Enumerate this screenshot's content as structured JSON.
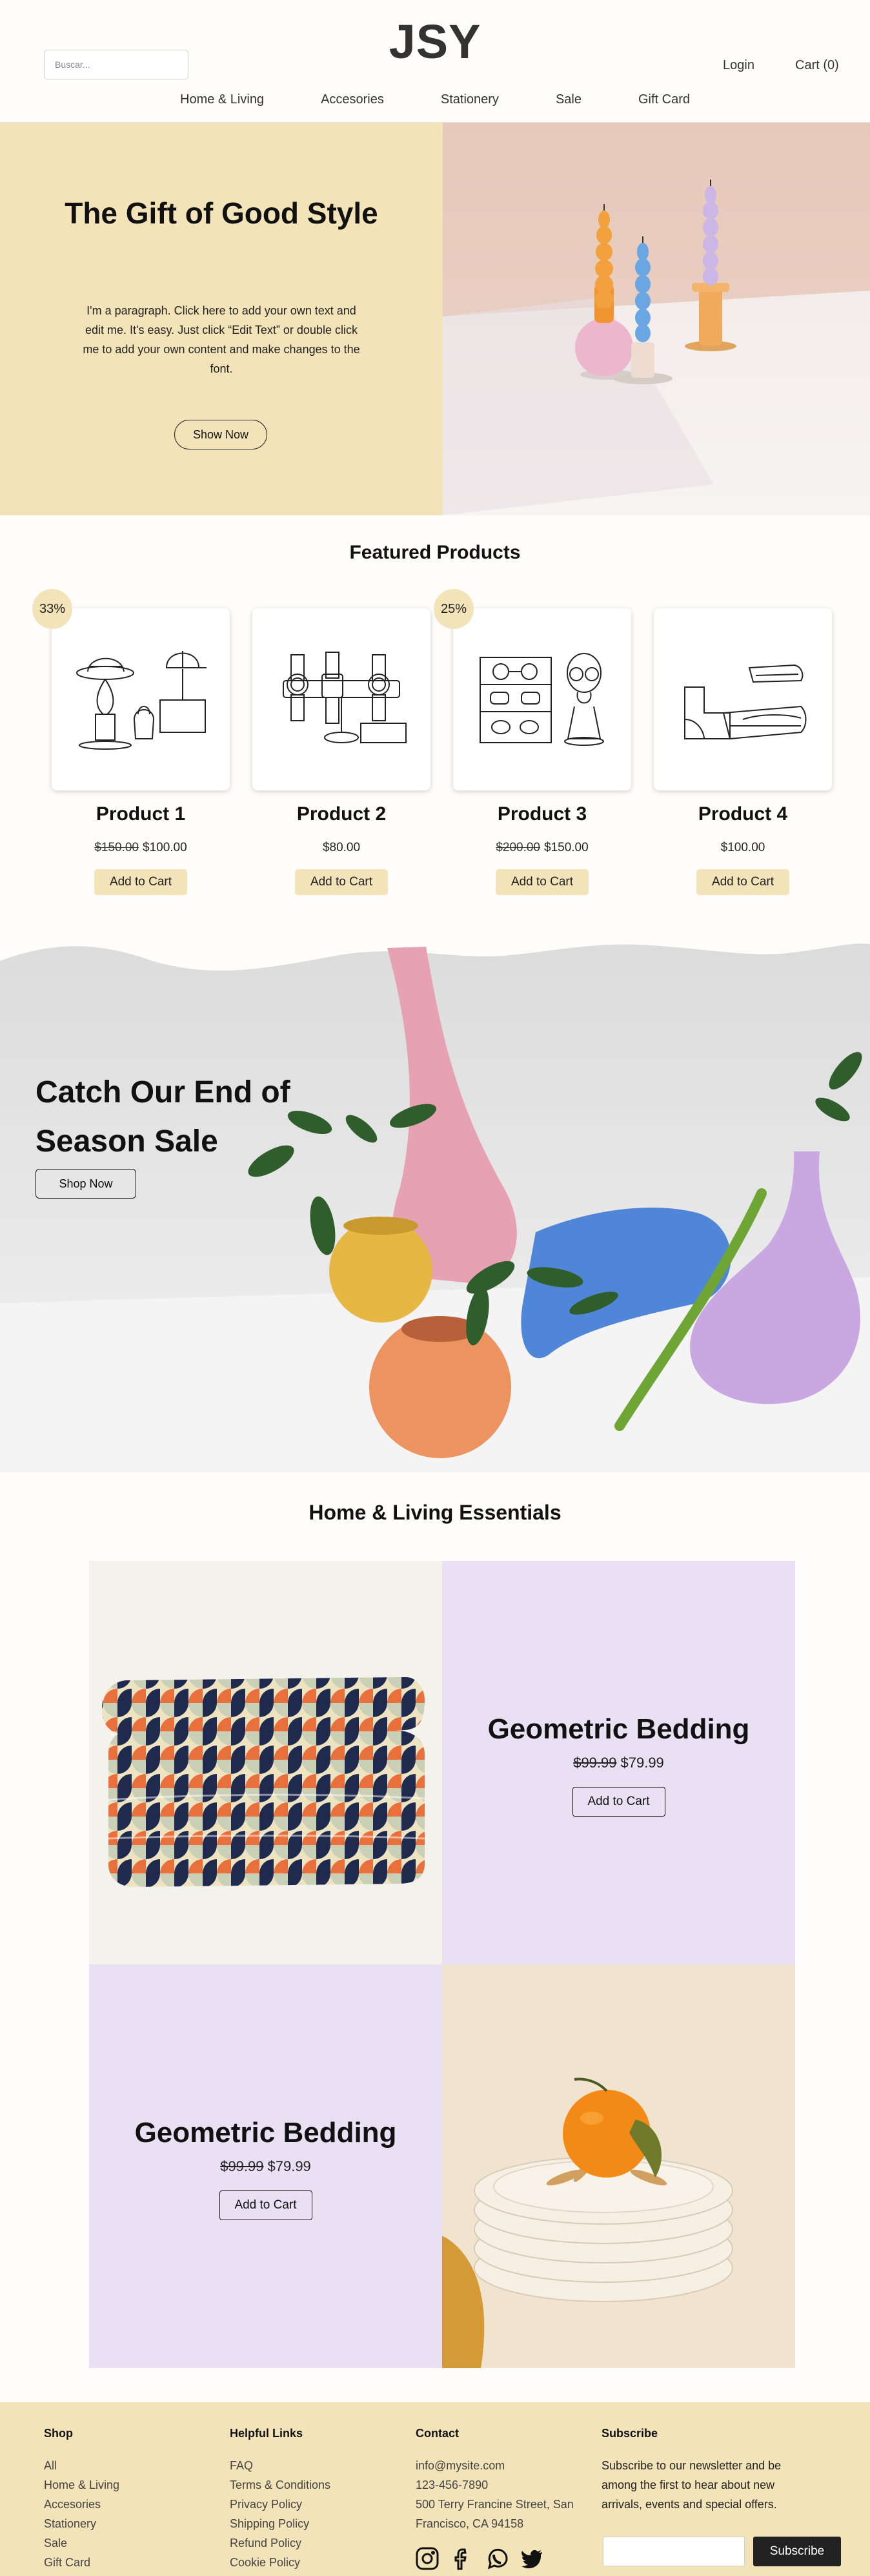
{
  "header": {
    "logo": "JSY",
    "search_placeholder": "Buscar...",
    "login": "Login",
    "cart": "Cart (0)",
    "nav": [
      "Home & Living",
      "Accesories",
      "Stationery",
      "Sale",
      "Gift Card"
    ]
  },
  "hero": {
    "title": "The Gift of Good Style",
    "text": "I'm a paragraph. Click here to add your own text and edit me. It's easy. Just click “Edit Text” or double click me to add your own content and make changes to the font.",
    "button": "Show Now"
  },
  "featured": {
    "title": "Featured Products",
    "products": [
      {
        "name": "Product 1",
        "old_price": "$150.00",
        "price": "$100.00",
        "badge": "33%",
        "button": "Add to Cart",
        "icon": "hats-icon"
      },
      {
        "name": "Product 2",
        "old_price": "",
        "price": "$80.00",
        "badge": "",
        "button": "Add to Cart",
        "icon": "watches-icon"
      },
      {
        "name": "Product 3",
        "old_price": "$200.00",
        "price": "$150.00",
        "badge": "25%",
        "button": "Add to Cart",
        "icon": "glasses-icon"
      },
      {
        "name": "Product 4",
        "old_price": "",
        "price": "$100.00",
        "badge": "",
        "button": "Add to Cart",
        "icon": "shoes-icon"
      }
    ]
  },
  "sale": {
    "title_line1": "Catch Our End of",
    "title_line2": "Season Sale",
    "button": "Shop Now"
  },
  "essentials": {
    "title": "Home & Living Essentials",
    "items": [
      {
        "name": "Geometric Bedding",
        "old_price": "$99.99",
        "price": "$79.99",
        "button": "Add to Cart"
      },
      {
        "name": "Geometric Bedding",
        "old_price": "$99.99",
        "price": "$79.99",
        "button": "Add to Cart"
      }
    ]
  },
  "footer": {
    "shop": {
      "title": "Shop",
      "links": [
        "All",
        "Home & Living",
        "Accesories",
        "Stationery",
        "Sale",
        "Gift Card"
      ]
    },
    "helpful": {
      "title": "Helpful Links",
      "links": [
        "FAQ",
        "Terms & Conditions",
        "Privacy Policy",
        "Shipping Policy",
        "Refund Policy",
        "Cookie Policy"
      ]
    },
    "contact": {
      "title": "Contact",
      "email": "info@mysite.com",
      "phone": "123-456-7890",
      "address_line1": "500 Terry Francine Street, San",
      "address_line2": "Francisco, CA 94158"
    },
    "subscribe": {
      "title": "Subscribe",
      "text": "Subscribe to our newsletter and be among the first to hear about new arrivals, events and special offers.",
      "button": "Subscribe"
    },
    "social": [
      "instagram-icon",
      "facebook-icon",
      "whatsapp-icon",
      "twitter-icon"
    ]
  },
  "colors": {
    "accent": "#f2e3b8",
    "lavender": "#e9e0f4",
    "dark": "#222222"
  }
}
